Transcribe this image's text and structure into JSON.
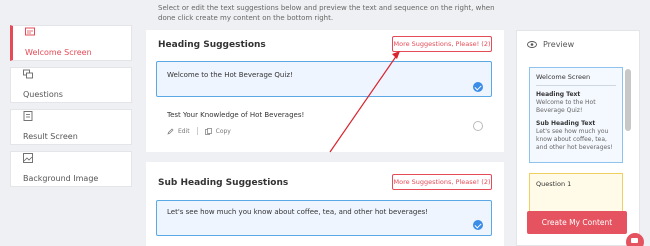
{
  "instructions": "Select or edit the text suggestions below and preview the text and sequence on the right, when done click create my content on the bottom right.",
  "nav": {
    "items": [
      {
        "label": "Welcome Screen"
      },
      {
        "label": "Questions"
      },
      {
        "label": "Result Screen"
      },
      {
        "label": "Background Image"
      }
    ]
  },
  "heading_panel": {
    "title": "Heading Suggestions",
    "more_label": "More Suggestions, Please! (2)",
    "suggestions": [
      {
        "text": "Welcome to the Hot Beverage Quiz!"
      },
      {
        "text": "Test Your Knowledge of Hot Beverages!"
      }
    ],
    "edit_label": "Edit",
    "copy_label": "Copy"
  },
  "subheading_panel": {
    "title": "Sub Heading Suggestions",
    "more_label": "More Suggestions, Please! (2)",
    "suggestions": [
      {
        "text": "Let's see how much you know about coffee, tea, and other hot beverages!"
      }
    ]
  },
  "preview": {
    "title": "Preview",
    "card": {
      "title": "Welcome Screen",
      "heading_label": "Heading Text",
      "heading_value": "Welcome to the Hot Beverage Quiz!",
      "sub_label": "Sub Heading Text",
      "sub_value": "Let's see how much you know about coffee, tea, and other hot beverages!"
    },
    "card2_title": "Question 1"
  },
  "create_label": "Create My Content",
  "colors": {
    "accent": "#e44b57",
    "selected": "#3b8de8"
  }
}
